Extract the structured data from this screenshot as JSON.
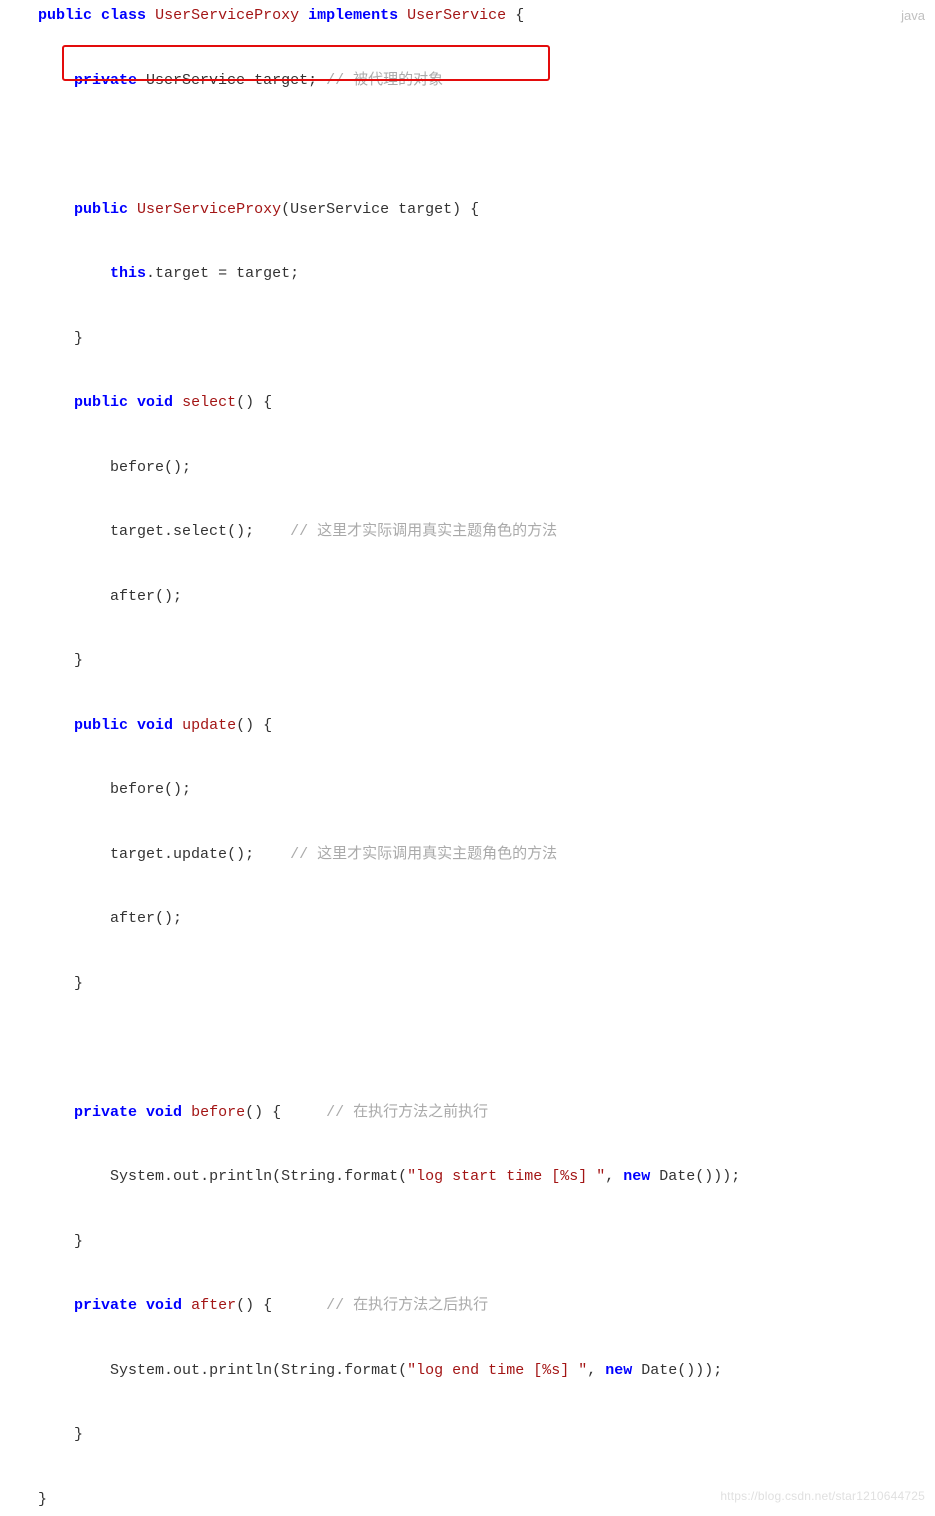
{
  "lang_label": "java",
  "watermark": "https://blog.csdn.net/star1210644725",
  "tokens": {
    "kw_public": "public",
    "kw_class": "class",
    "kw_implements": "implements",
    "kw_private": "private",
    "kw_void": "void",
    "kw_this": "this",
    "kw_new": "new",
    "type_UserService": "UserService",
    "type_UserServiceProxy": "UserServiceProxy",
    "id_target": "target",
    "method_select": "select",
    "method_update": "update",
    "method_before": "before",
    "method_after": "after",
    "id_System": "System",
    "id_out": "out",
    "id_println": "println",
    "id_String": "String",
    "id_format": "format",
    "id_Date": "Date",
    "str_log_start": "\"log start time [%s] \"",
    "str_log_end": "\"log end time [%s] \"",
    "cmt_proxied_obj": "// 被代理的对象",
    "cmt_real_call": "// 这里才实际调用真实主题角色的方法",
    "cmt_before_exec": "// 在执行方法之前执行",
    "cmt_after_exec": "// 在执行方法之后执行"
  }
}
